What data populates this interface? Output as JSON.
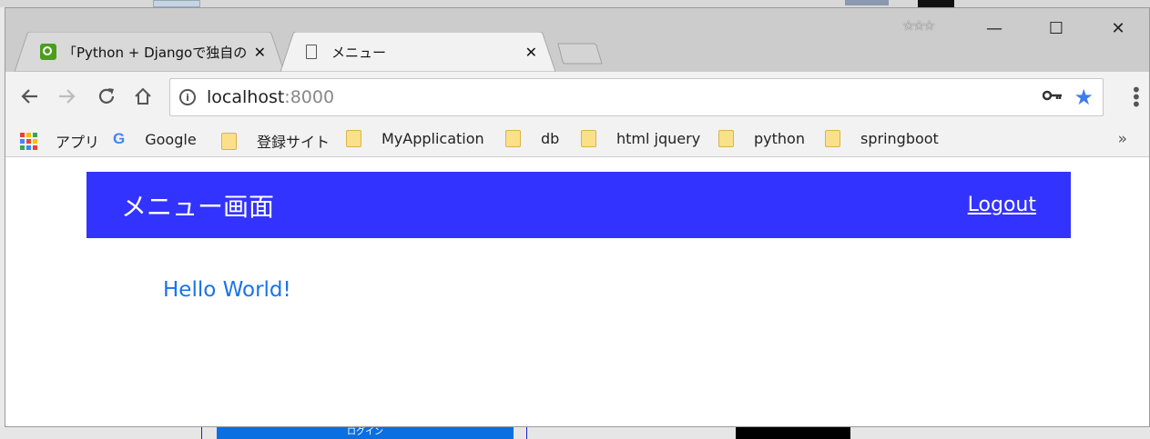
{
  "browser": {
    "tabs": [
      {
        "title": "「Python + Djangoで独自の",
        "close": "✕",
        "active": false
      },
      {
        "title": "メニュー",
        "close": "✕",
        "active": true
      }
    ],
    "address": {
      "host": "localhost",
      "port": ":8000"
    },
    "window_controls": {
      "minimize": "—",
      "maximize": "☐",
      "close": "✕"
    },
    "stars": "☆☆☆",
    "bookmarks": [
      {
        "label": "アプリ",
        "icon": "apps-icon"
      },
      {
        "label": "Google",
        "icon": "google-icon"
      },
      {
        "label": "登録サイト",
        "icon": "folder-icon"
      },
      {
        "label": "MyApplication",
        "icon": "folder-icon"
      },
      {
        "label": "db",
        "icon": "folder-icon"
      },
      {
        "label": "html jquery",
        "icon": "folder-icon"
      },
      {
        "label": "python",
        "icon": "folder-icon"
      },
      {
        "label": "springboot",
        "icon": "folder-icon"
      }
    ],
    "bookmarks_more": "»"
  },
  "page": {
    "title": "メニュー画面",
    "logout_label": "Logout",
    "greeting": "Hello World!",
    "header_color": "#3333ff",
    "greeting_color": "#1a73e8"
  },
  "background": {
    "button_label": "ログイン"
  }
}
